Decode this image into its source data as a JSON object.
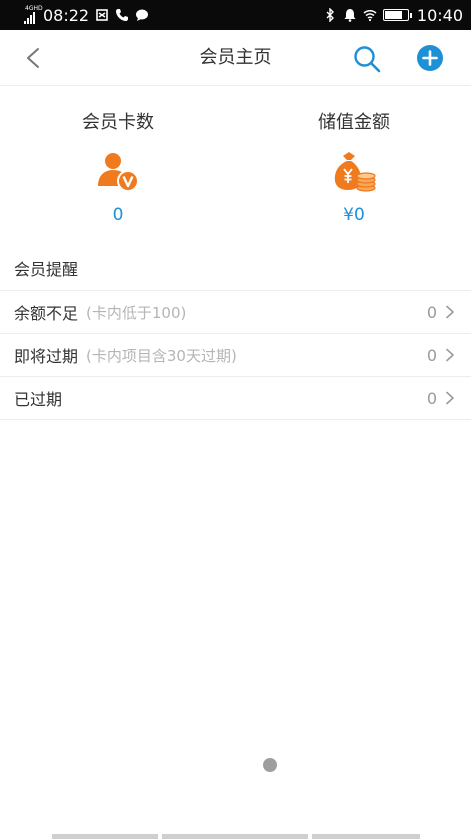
{
  "status_bar": {
    "network": "4GHD",
    "time_left": "08:22",
    "time_right": "10:40"
  },
  "header": {
    "title": "会员主页"
  },
  "stats": {
    "cards": {
      "label": "会员卡数",
      "value": "0"
    },
    "balance": {
      "label": "储值金额",
      "value": "¥0"
    }
  },
  "reminders": {
    "title": "会员提醒",
    "rows": [
      {
        "label": "余额不足",
        "note": "(卡内低于100)",
        "count": "0"
      },
      {
        "label": "即将过期",
        "note": "(卡内项目含30天过期)",
        "count": "0"
      },
      {
        "label": "已过期",
        "note": "",
        "count": "0"
      }
    ]
  },
  "colors": {
    "accent_blue": "#1e90d6",
    "icon_orange": "#f07a1e"
  }
}
